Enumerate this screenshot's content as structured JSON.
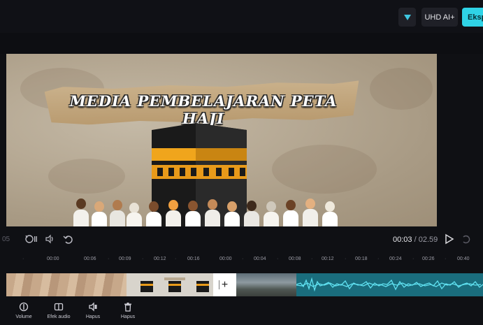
{
  "header": {
    "uhd_label": "UHD AI+",
    "export_label": "Ekspor",
    "dropdown_icon": "triangle-down-icon",
    "accent_color": "#2fd3e6"
  },
  "preview": {
    "title": "MEDIA PEMBELAJARAN PETA HAJI"
  },
  "controls": {
    "left_cut_text": "05",
    "current_time": "00:03",
    "separator": " / ",
    "total_time": "02.59"
  },
  "timeline": {
    "ticks": [
      "00:00",
      "00:06",
      "00:09",
      "00:12",
      "00:16",
      "00:00",
      "00:04",
      "00:08",
      "00:12",
      "00:18",
      "00:24",
      "00:26",
      "00:40"
    ]
  },
  "toolbar": {
    "items": [
      {
        "label": "Volume",
        "icon": "volume-icon"
      },
      {
        "label": "Efek audio",
        "icon": "audio-effect-icon"
      },
      {
        "label": "Hapus",
        "icon": "mute-icon"
      },
      {
        "label": "Hapus",
        "icon": "trash-icon"
      }
    ]
  }
}
